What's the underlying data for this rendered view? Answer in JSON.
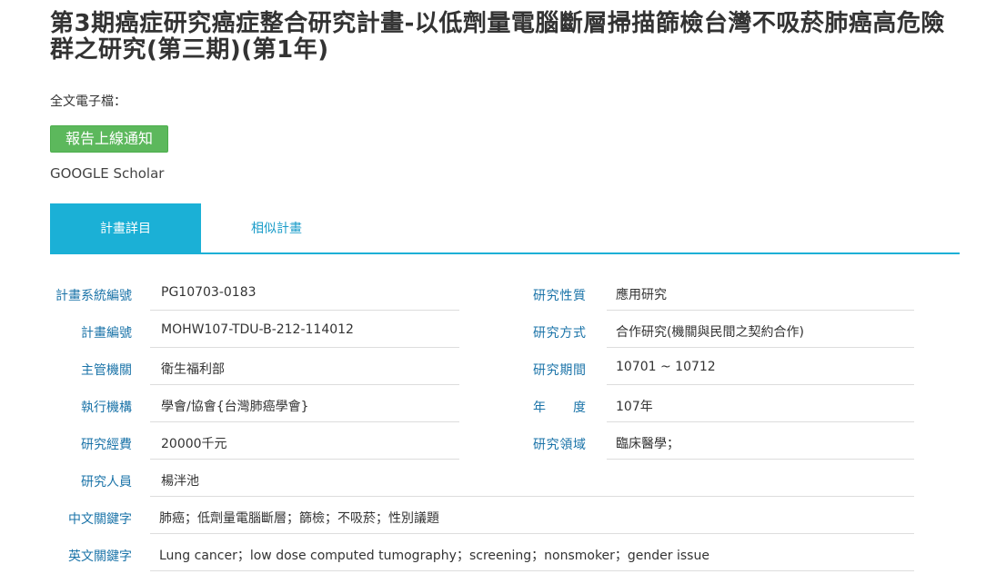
{
  "page": {
    "title": "第3期癌症研究癌症整合研究計畫-以低劑量電腦斷層掃描篩檢台灣不吸菸肺癌高危險群之研究(第三期)(第1年)",
    "fulltext_label": "全文電子檔：",
    "notify_button": "報告上線通知",
    "scholar_link": "GOOGLE Scholar"
  },
  "tabs": [
    {
      "label": "計畫詳目",
      "active": true
    },
    {
      "label": "相似計畫",
      "active": false
    }
  ],
  "colors": {
    "accent": "#1bb0d6",
    "label_blue": "#1a73a8",
    "button_green": "#5cb85c"
  },
  "details_left": [
    {
      "label": "計畫系統編號",
      "value": "PG10703-0183"
    },
    {
      "label": "計畫編號",
      "value": "MOHW107-TDU-B-212-114012"
    },
    {
      "label": "主管機關",
      "value": "衛生福利部"
    },
    {
      "label": "執行機構",
      "value": "學會/協會{台灣肺癌學會}"
    },
    {
      "label": "研究經費",
      "value": "20000千元"
    },
    {
      "label": "研究人員",
      "value": "楊泮池"
    },
    {
      "label": "中文關鍵字",
      "value": "肺癌；低劑量電腦斷層；篩檢；不吸菸；性別議題"
    },
    {
      "label": "英文關鍵字",
      "value": "Lung cancer；low dose computed tumography；screening；nonsmoker；gender issue"
    }
  ],
  "details_right": [
    {
      "label": "研究性質",
      "value": "應用研究"
    },
    {
      "label": "研究方式",
      "value": "合作研究(機關與民間之契約合作)"
    },
    {
      "label": "研究期間",
      "value": "10701 ~ 10712"
    },
    {
      "label": "年　　度",
      "value": "107年"
    },
    {
      "label": "研究領域",
      "value": "臨床醫學；"
    }
  ]
}
